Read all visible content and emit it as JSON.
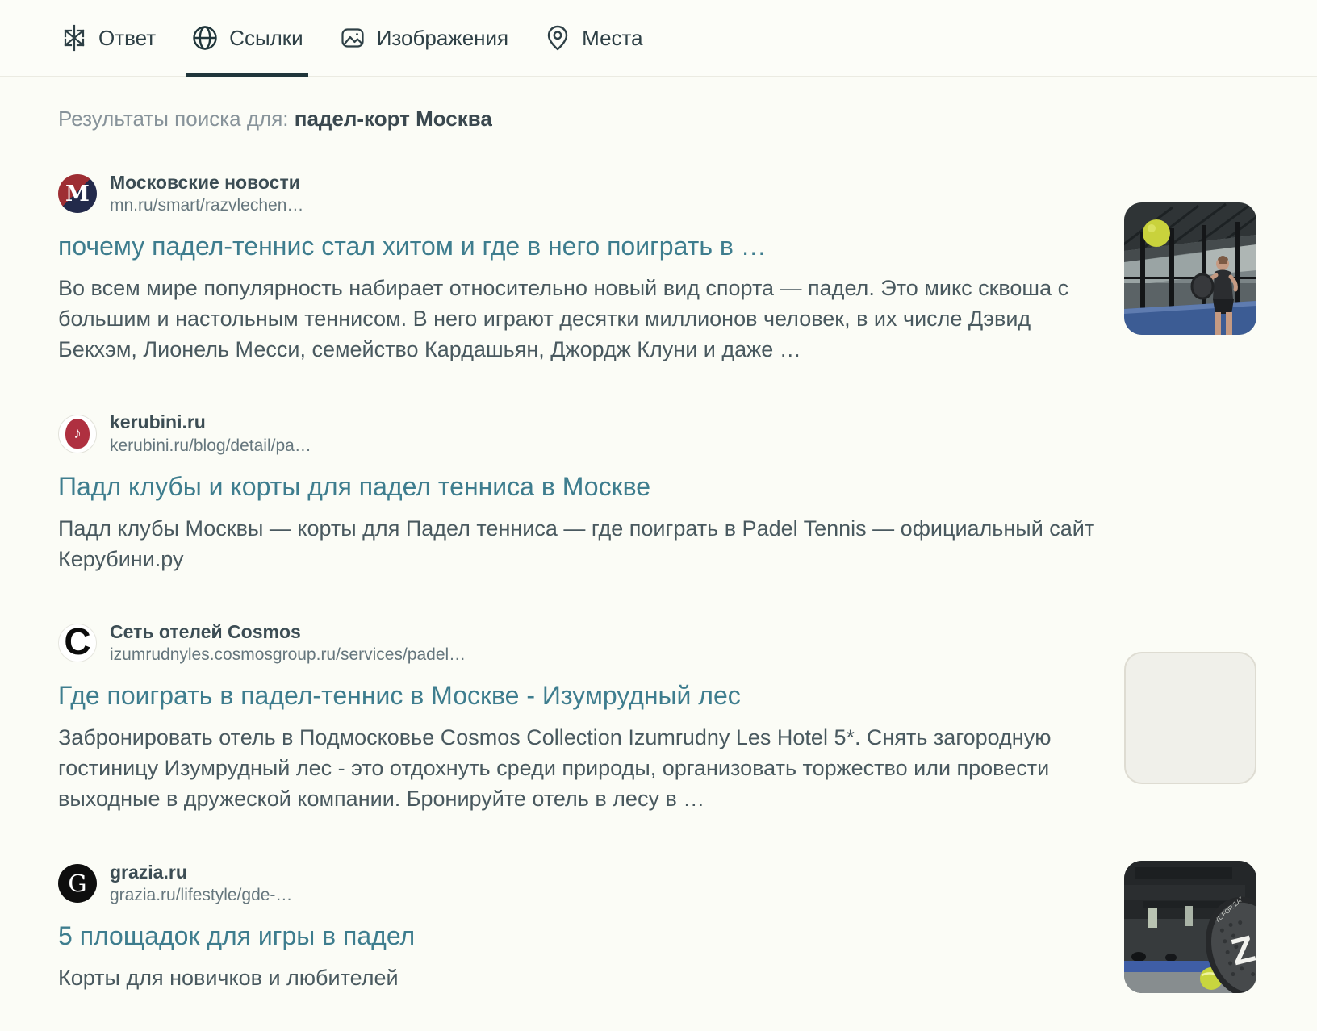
{
  "tabs": [
    {
      "label": "Ответ",
      "icon": "sparkle-logo-icon",
      "active": false
    },
    {
      "label": "Ссылки",
      "icon": "globe-icon",
      "active": true
    },
    {
      "label": "Изображения",
      "icon": "images-icon",
      "active": false
    },
    {
      "label": "Места",
      "icon": "places-pin-icon",
      "active": false
    }
  ],
  "search_summary": {
    "label": "Результаты поиска для:",
    "query": "падел-корт Москва"
  },
  "results": [
    {
      "source": "Московские новости",
      "url": "mn.ru/smart/razvlechen…",
      "title": "почему падел-теннис стал хитом и где в него поиграть в …",
      "description": "Во всем мире популярность набирает относительно новый вид спорта — падел. Это микс сквоша с большим и настольным теннисом. В него играют десятки миллионов человек, в их числе Дэвид Бекхэм, Лионель Месси, семейство Кардашьян, Джордж Клуни и даже …",
      "favicon_letter": "M",
      "thumbnail": "padel-player-photo"
    },
    {
      "source": "kerubini.ru",
      "url": "kerubini.ru/blog/detail/pa…",
      "title": "Падл клубы и корты для падел тенниса в Москве",
      "description": "Падл клубы Москвы — корты для Падел тенниса — где поиграть в Padel Tennis — официальный сайт Керубини.ру",
      "favicon_letter": "♪",
      "thumbnail": "none"
    },
    {
      "source": "Сеть отелей Cosmos",
      "url": "izumrudnyles.cosmosgroup.ru/services/padel…",
      "title": "Где поиграть в падел-теннис в Москве - Изумрудный лес",
      "description": "Забронировать отель в Подмосковье Cosmos Collection Izumrudny Les Hotel 5*. Снять загородную гостиницу Изумрудный лес - это отдохнуть среди природы, организовать торжество или провести выходные в дружеской компании. Бронируйте отель в лесу в …",
      "favicon_letter": "C",
      "thumbnail": "empty-placeholder"
    },
    {
      "source": "grazia.ru",
      "url": "grazia.ru/lifestyle/gde-…",
      "title": "5 площадок для игры в падел",
      "description": "Корты для новичков и любителей",
      "favicon_letter": "G",
      "thumbnail": "padel-racket-photo"
    }
  ],
  "colors": {
    "background": "#fbfcf6",
    "title_link": "#3e7d8e",
    "tab_underline": "#20363b",
    "description_text": "#49595f",
    "favicon_mn_red": "#9e2e33",
    "favicon_mn_navy": "#232a4b",
    "favicon_kerubini_red": "#af3040",
    "favicon_grazia_black": "#0e0e0e"
  }
}
